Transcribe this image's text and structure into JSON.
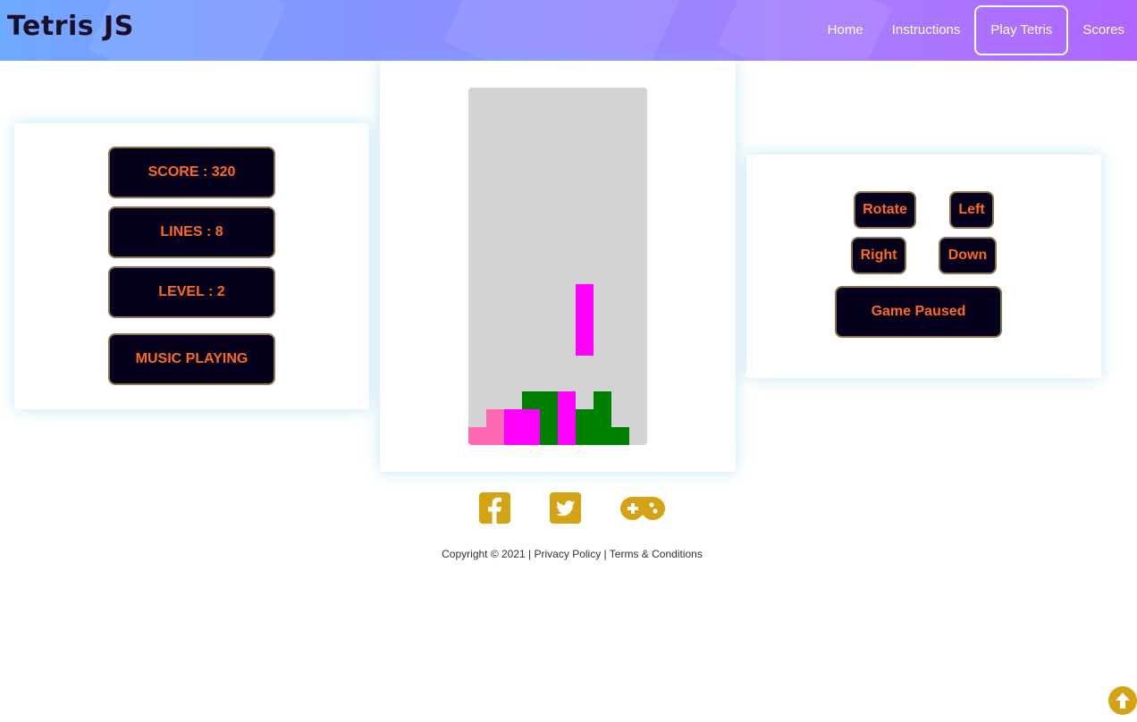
{
  "header": {
    "brand": "Tetris JS",
    "nav": [
      "Home",
      "Instructions",
      "Play Tetris",
      "Scores"
    ],
    "active_index": 2
  },
  "stats": {
    "score": "SCORE : 320",
    "lines": "LINES : 8",
    "level": "LEVEL : 2",
    "music": "MUSIC PLAYING"
  },
  "board": {
    "columns": 10,
    "rows": 20,
    "colors": {
      "pink": "#ff69b4",
      "magenta": "#ff00ff",
      "green": "#008000",
      "empty": "#d3d3d3"
    },
    "cells": [
      {
        "c": 6,
        "r": 11,
        "color": "magenta"
      },
      {
        "c": 6,
        "r": 12,
        "color": "magenta"
      },
      {
        "c": 6,
        "r": 13,
        "color": "magenta"
      },
      {
        "c": 6,
        "r": 14,
        "color": "magenta"
      },
      {
        "c": 3,
        "r": 17,
        "color": "green"
      },
      {
        "c": 4,
        "r": 17,
        "color": "green"
      },
      {
        "c": 5,
        "r": 17,
        "color": "magenta"
      },
      {
        "c": 7,
        "r": 17,
        "color": "green"
      },
      {
        "c": 1,
        "r": 18,
        "color": "pink"
      },
      {
        "c": 2,
        "r": 18,
        "color": "magenta"
      },
      {
        "c": 3,
        "r": 18,
        "color": "magenta"
      },
      {
        "c": 4,
        "r": 18,
        "color": "green"
      },
      {
        "c": 5,
        "r": 18,
        "color": "magenta"
      },
      {
        "c": 6,
        "r": 18,
        "color": "green"
      },
      {
        "c": 7,
        "r": 18,
        "color": "green"
      },
      {
        "c": 0,
        "r": 19,
        "color": "pink"
      },
      {
        "c": 1,
        "r": 19,
        "color": "pink"
      },
      {
        "c": 2,
        "r": 19,
        "color": "magenta"
      },
      {
        "c": 3,
        "r": 19,
        "color": "magenta"
      },
      {
        "c": 4,
        "r": 19,
        "color": "green"
      },
      {
        "c": 5,
        "r": 19,
        "color": "magenta"
      },
      {
        "c": 6,
        "r": 19,
        "color": "green"
      },
      {
        "c": 7,
        "r": 19,
        "color": "green"
      },
      {
        "c": 8,
        "r": 19,
        "color": "green"
      }
    ]
  },
  "controls": {
    "rotate": "Rotate",
    "left": "Left",
    "right": "Right",
    "down": "Down",
    "pause": "Game Paused"
  },
  "social": {
    "icons": [
      "facebook-icon",
      "twitter-icon",
      "gamepad-icon"
    ],
    "color": "#d4a313"
  },
  "footer": {
    "copyright": "Copyright © 2021",
    "sep": "|",
    "privacy": "Privacy Policy",
    "terms": "Terms & Conditions"
  },
  "accent": {
    "button_bg": "#05001c",
    "button_text": "#ff6a1a"
  }
}
